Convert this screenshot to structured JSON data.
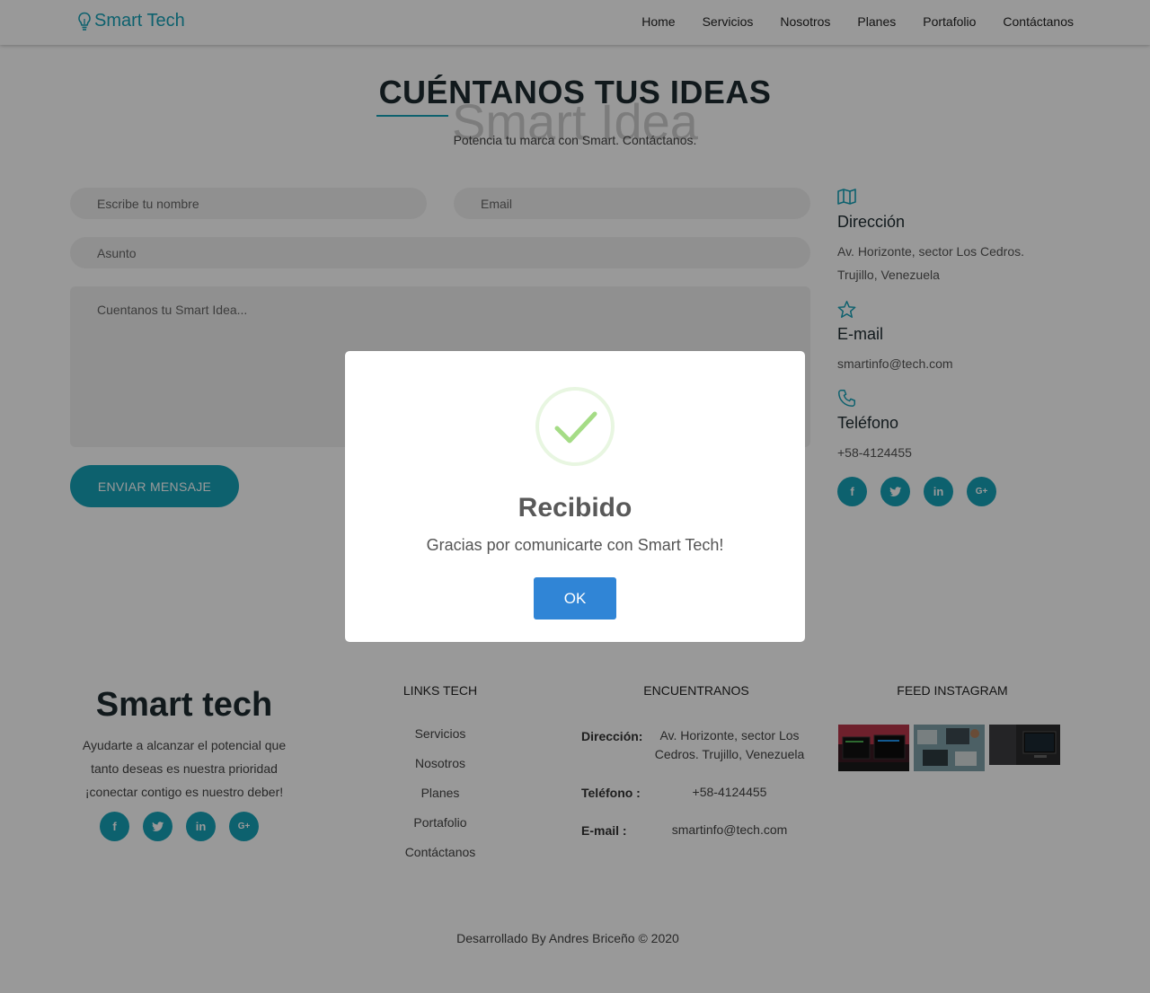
{
  "navbar": {
    "brand": "Smart Tech",
    "links": [
      "Home",
      "Servicios",
      "Nosotros",
      "Planes",
      "Portafolio",
      "Contáctanos"
    ]
  },
  "header": {
    "title": "CUÉNTANOS TUS IDEAS",
    "watermark": "Smart Idea",
    "subtitle": "Potencia tu marca con Smart. Contáctanos."
  },
  "form": {
    "name_placeholder": "Escribe tu nombre",
    "email_placeholder": "Email",
    "subject_placeholder": "Asunto",
    "message_placeholder": "Cuentanos tu Smart Idea...",
    "send_label": "ENVIAR MENSAJE"
  },
  "contact_info": {
    "address_title": "Dirección",
    "address_line1": "Av. Horizonte, sector Los Cedros.",
    "address_line2": "Trujillo, Venezuela",
    "email_title": "E-mail",
    "email_value": "smartinfo@tech.com",
    "phone_title": "Teléfono",
    "phone_value": "+58-4124455"
  },
  "social_icons": [
    "facebook-icon",
    "twitter-icon",
    "linkedin-icon",
    "google-plus-icon"
  ],
  "footer": {
    "brand": "Smart tech",
    "desc_line1": "Ayudarte a alcanzar el potencial que",
    "desc_line2": "tanto deseas es nuestra prioridad",
    "desc_line3": "¡conectar contigo es nuestro deber!",
    "links_title": "LINKS TECH",
    "links": [
      "Servicios",
      "Nosotros",
      "Planes",
      "Portafolio",
      "Contáctanos"
    ],
    "find_title": "ENCUENTRANOS",
    "find_address_label": "Dirección:",
    "find_address_line1": "Av. Horizonte, sector Los",
    "find_address_line2": "Cedros. Trujillo, Venezuela",
    "find_phone_label": "Teléfono :",
    "find_phone_value": "+58-4124455",
    "find_email_label": "E-mail :",
    "find_email_value": "smartinfo@tech.com",
    "instagram_title": "FEED INSTAGRAM",
    "copyright": "Desarrollado By Andres Briceño © 2020"
  },
  "modal": {
    "title": "Recibido",
    "text": "Gracias por comunicarte con Smart Tech!",
    "ok_label": "OK"
  },
  "colors": {
    "accent": "#17a2b8",
    "ok_button": "#3085d6",
    "success": "#a5dc86"
  }
}
